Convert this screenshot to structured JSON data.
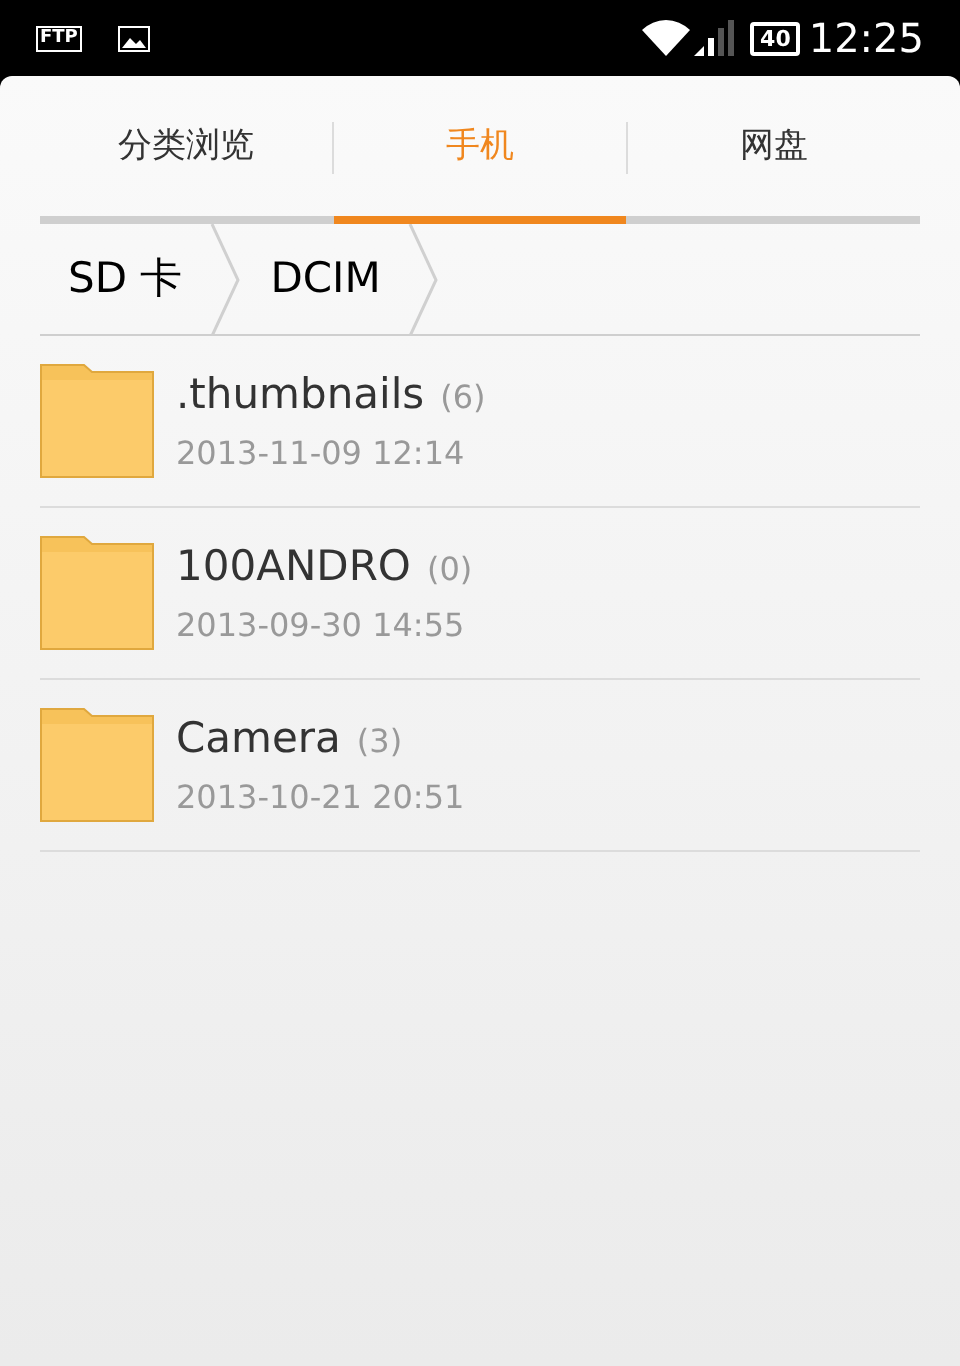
{
  "status_bar": {
    "ftp_label": "FTP",
    "battery": "40",
    "time": "12:25"
  },
  "tabs": [
    {
      "label": "分类浏览",
      "selected": false
    },
    {
      "label": "手机",
      "selected": true
    },
    {
      "label": "网盘",
      "selected": false
    }
  ],
  "breadcrumb": [
    "SD 卡",
    "DCIM"
  ],
  "files": [
    {
      "name": ".thumbnails",
      "count": "(6)",
      "date": "2013-11-09 12:14"
    },
    {
      "name": "100ANDRO",
      "count": "(0)",
      "date": "2013-09-30 14:55"
    },
    {
      "name": "Camera",
      "count": "(3)",
      "date": "2013-10-21 20:51"
    }
  ]
}
